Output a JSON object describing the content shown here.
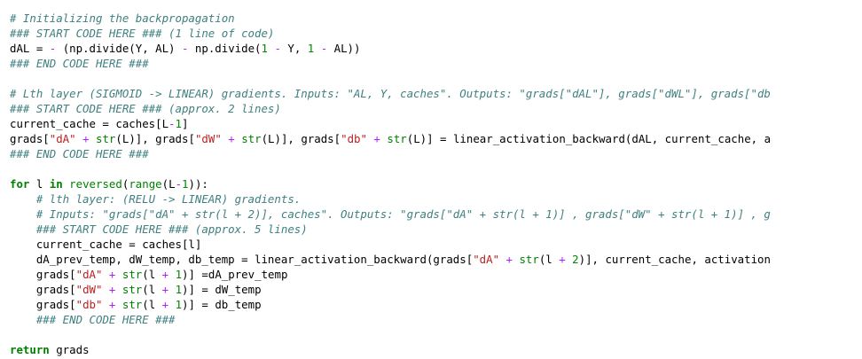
{
  "colors": {
    "background": "#ffffff",
    "text": "#000000",
    "comment": "#408080",
    "keyword": "#008000",
    "builtin": "#008000",
    "string": "#ba2121",
    "number": "#008800",
    "operator": "#aa22ff"
  },
  "code_lines": [
    [
      [
        "c",
        "# Initializing the backpropagation"
      ]
    ],
    [
      [
        "c",
        "### START CODE HERE ### (1 line of code)"
      ]
    ],
    [
      [
        "t",
        "dAL = "
      ],
      [
        "o",
        "-"
      ],
      [
        "t",
        " (np.divide(Y, AL) "
      ],
      [
        "o",
        "-"
      ],
      [
        "t",
        " np.divide("
      ],
      [
        "n",
        "1"
      ],
      [
        "t",
        " "
      ],
      [
        "o",
        "-"
      ],
      [
        "t",
        " Y, "
      ],
      [
        "n",
        "1"
      ],
      [
        "t",
        " "
      ],
      [
        "o",
        "-"
      ],
      [
        "t",
        " AL))"
      ]
    ],
    [
      [
        "c",
        "### END CODE HERE ###"
      ]
    ],
    [],
    [
      [
        "c",
        "# Lth layer (SIGMOID -> LINEAR) gradients. Inputs: \"AL, Y, caches\". Outputs: \"grads[\"dAL\"], grads[\"dWL\"], grads[\"db"
      ]
    ],
    [
      [
        "c",
        "### START CODE HERE ### (approx. 2 lines)"
      ]
    ],
    [
      [
        "t",
        "current_cache = caches[L"
      ],
      [
        "o",
        "-"
      ],
      [
        "n",
        "1"
      ],
      [
        "t",
        "]"
      ]
    ],
    [
      [
        "t",
        "grads["
      ],
      [
        "s",
        "\"dA\""
      ],
      [
        "t",
        " "
      ],
      [
        "o",
        "+"
      ],
      [
        "t",
        " "
      ],
      [
        "b",
        "str"
      ],
      [
        "t",
        "(L)], grads["
      ],
      [
        "s",
        "\"dW\""
      ],
      [
        "t",
        " "
      ],
      [
        "o",
        "+"
      ],
      [
        "t",
        " "
      ],
      [
        "b",
        "str"
      ],
      [
        "t",
        "(L)], grads["
      ],
      [
        "s",
        "\"db\""
      ],
      [
        "t",
        " "
      ],
      [
        "o",
        "+"
      ],
      [
        "t",
        " "
      ],
      [
        "b",
        "str"
      ],
      [
        "t",
        "(L)] = linear_activation_backward(dAL, current_cache, a"
      ]
    ],
    [
      [
        "c",
        "### END CODE HERE ###"
      ]
    ],
    [],
    [
      [
        "k",
        "for"
      ],
      [
        "t",
        " l "
      ],
      [
        "k",
        "in"
      ],
      [
        "t",
        " "
      ],
      [
        "b",
        "reversed"
      ],
      [
        "t",
        "("
      ],
      [
        "b",
        "range"
      ],
      [
        "t",
        "(L"
      ],
      [
        "o",
        "-"
      ],
      [
        "n",
        "1"
      ],
      [
        "t",
        ")):"
      ]
    ],
    [
      [
        "t",
        "    "
      ],
      [
        "c",
        "# lth layer: (RELU -> LINEAR) gradients."
      ]
    ],
    [
      [
        "t",
        "    "
      ],
      [
        "c",
        "# Inputs: \"grads[\"dA\" + str(l + 2)], caches\". Outputs: \"grads[\"dA\" + str(l + 1)] , grads[\"dW\" + str(l + 1)] , g"
      ]
    ],
    [
      [
        "t",
        "    "
      ],
      [
        "c",
        "### START CODE HERE ### (approx. 5 lines)"
      ]
    ],
    [
      [
        "t",
        "    current_cache = caches[l]"
      ]
    ],
    [
      [
        "t",
        "    dA_prev_temp, dW_temp, db_temp = linear_activation_backward(grads["
      ],
      [
        "s",
        "\"dA\""
      ],
      [
        "t",
        " "
      ],
      [
        "o",
        "+"
      ],
      [
        "t",
        " "
      ],
      [
        "b",
        "str"
      ],
      [
        "t",
        "(l "
      ],
      [
        "o",
        "+"
      ],
      [
        "t",
        " "
      ],
      [
        "n",
        "2"
      ],
      [
        "t",
        ")], current_cache, activation"
      ]
    ],
    [
      [
        "t",
        "    grads["
      ],
      [
        "s",
        "\"dA\""
      ],
      [
        "t",
        " "
      ],
      [
        "o",
        "+"
      ],
      [
        "t",
        " "
      ],
      [
        "b",
        "str"
      ],
      [
        "t",
        "(l "
      ],
      [
        "o",
        "+"
      ],
      [
        "t",
        " "
      ],
      [
        "n",
        "1"
      ],
      [
        "t",
        ")] =dA_prev_temp"
      ]
    ],
    [
      [
        "t",
        "    grads["
      ],
      [
        "s",
        "\"dW\""
      ],
      [
        "t",
        " "
      ],
      [
        "o",
        "+"
      ],
      [
        "t",
        " "
      ],
      [
        "b",
        "str"
      ],
      [
        "t",
        "(l "
      ],
      [
        "o",
        "+"
      ],
      [
        "t",
        " "
      ],
      [
        "n",
        "1"
      ],
      [
        "t",
        ")] = dW_temp"
      ]
    ],
    [
      [
        "t",
        "    grads["
      ],
      [
        "s",
        "\"db\""
      ],
      [
        "t",
        " "
      ],
      [
        "o",
        "+"
      ],
      [
        "t",
        " "
      ],
      [
        "b",
        "str"
      ],
      [
        "t",
        "(l "
      ],
      [
        "o",
        "+"
      ],
      [
        "t",
        " "
      ],
      [
        "n",
        "1"
      ],
      [
        "t",
        ")] = db_temp"
      ]
    ],
    [
      [
        "t",
        "    "
      ],
      [
        "c",
        "### END CODE HERE ###"
      ]
    ],
    [],
    [
      [
        "k",
        "return"
      ],
      [
        "t",
        " grads"
      ]
    ]
  ]
}
